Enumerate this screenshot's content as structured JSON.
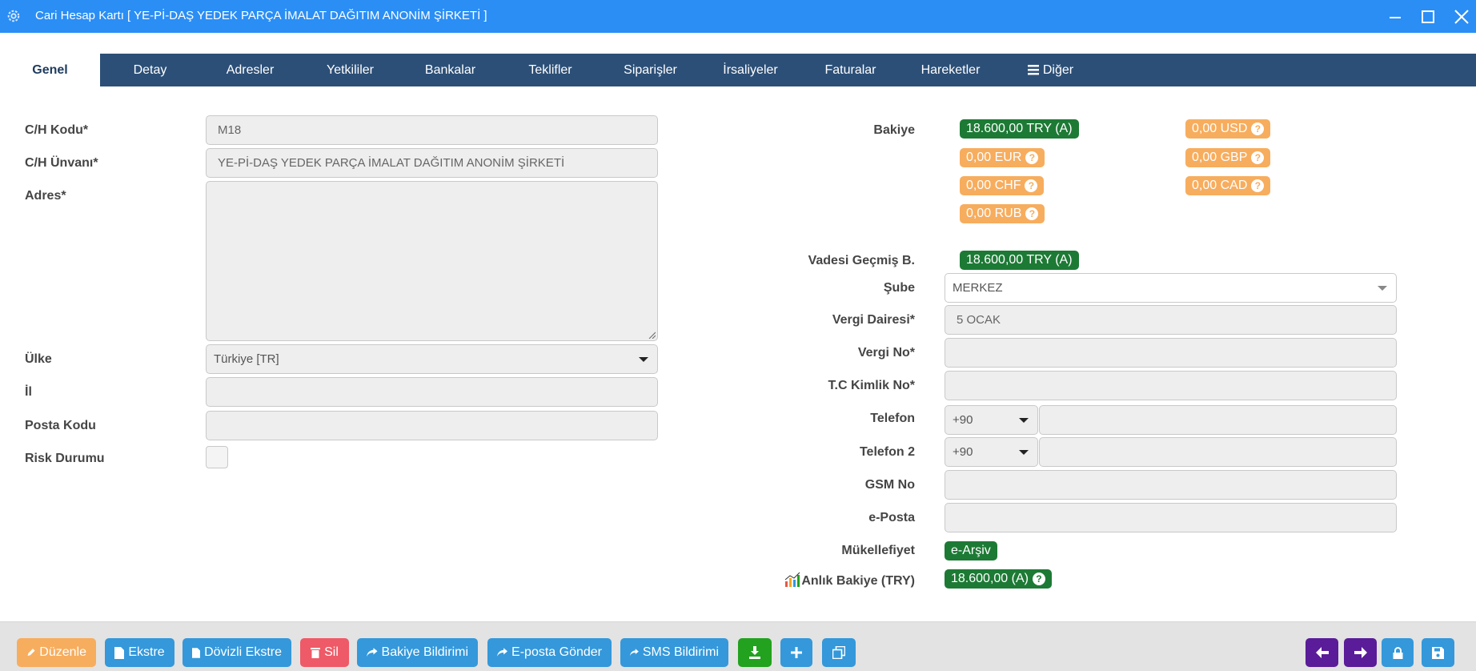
{
  "window": {
    "title": "Cari Hesap Kartı [ YE-Pİ-DAŞ YEDEK PARÇA İMALAT DAĞITIM ANONİM ŞİRKETİ ]"
  },
  "tabs": [
    {
      "label": "Genel",
      "active": true
    },
    {
      "label": "Detay"
    },
    {
      "label": "Adresler"
    },
    {
      "label": "Yetkililer"
    },
    {
      "label": "Bankalar"
    },
    {
      "label": "Teklifler"
    },
    {
      "label": "Siparişler"
    },
    {
      "label": "İrsaliyeler"
    },
    {
      "label": "Faturalar"
    },
    {
      "label": "Hareketler"
    },
    {
      "label": "Diğer",
      "icon": "menu-icon"
    }
  ],
  "form_left": {
    "code_label": "C/H Kodu*",
    "code_value": "M18",
    "title_label": "C/H Ünvanı*",
    "title_value": "YE-Pİ-DAŞ YEDEK PARÇA İMALAT DAĞITIM ANONİM ŞİRKETİ",
    "address_label": "Adres*",
    "address_value": "",
    "country_label": "Ülke",
    "country_value": "Türkiye [TR]",
    "city_label": "İl",
    "city_value": "",
    "postal_label": "Posta Kodu",
    "postal_value": "",
    "risk_label": "Risk Durumu",
    "risk_checked": false
  },
  "form_right": {
    "balance_label": "Bakiye",
    "balances": [
      {
        "value": "18.600,00 TRY (A)",
        "color": "#1d7a35",
        "help": false
      },
      {
        "value": "0,00 USD",
        "color": "#f7ad5e",
        "help": true
      },
      {
        "value": "0,00 EUR",
        "color": "#f7ad5e",
        "help": true
      },
      {
        "value": "0,00 GBP",
        "color": "#f7ad5e",
        "help": true
      },
      {
        "value": "0,00 CHF",
        "color": "#f7ad5e",
        "help": true
      },
      {
        "value": "0,00 CAD",
        "color": "#f7ad5e",
        "help": true
      },
      {
        "value": "0,00 RUB",
        "color": "#f7ad5e",
        "help": true
      }
    ],
    "overdue_label": "Vadesi Geçmiş B.",
    "overdue_value": "18.600,00 TRY (A)",
    "branch_label": "Şube",
    "branch_value": "MERKEZ",
    "tax_office_label": "Vergi Dairesi*",
    "tax_office_value": "5 OCAK",
    "tax_no_label": "Vergi No*",
    "tax_no_value": "",
    "tc_label": "T.C Kimlik No*",
    "tc_value": "",
    "phone_label": "Telefon",
    "phone_code": "+90",
    "phone_value": "",
    "phone2_label": "Telefon 2",
    "phone2_code": "+90",
    "phone2_value": "",
    "gsm_label": "GSM No",
    "gsm_value": "",
    "email_label": "e-Posta",
    "email_value": "",
    "liability_label": "Mükellefiyet",
    "liability_value": "e-Arşiv",
    "instant_label": "Anlık Bakiye (TRY)",
    "instant_value": "18.600,00 (A)"
  },
  "toolbar": {
    "edit": "Düzenle",
    "statement": "Ekstre",
    "fx_statement": "Dövizli Ekstre",
    "delete": "Sil",
    "balance_notice": "Bakiye Bildirimi",
    "send_email": "E-posta Gönder",
    "sms_notice": "SMS Bildirimi"
  },
  "colors": {
    "titlebar": "#2a8ef5",
    "tabbar": "#2c4f77",
    "green": "#1d7a35",
    "orange": "#f7ad5e",
    "blue": "#3498db",
    "red": "#ee5a67",
    "purple": "#5a1c98"
  }
}
